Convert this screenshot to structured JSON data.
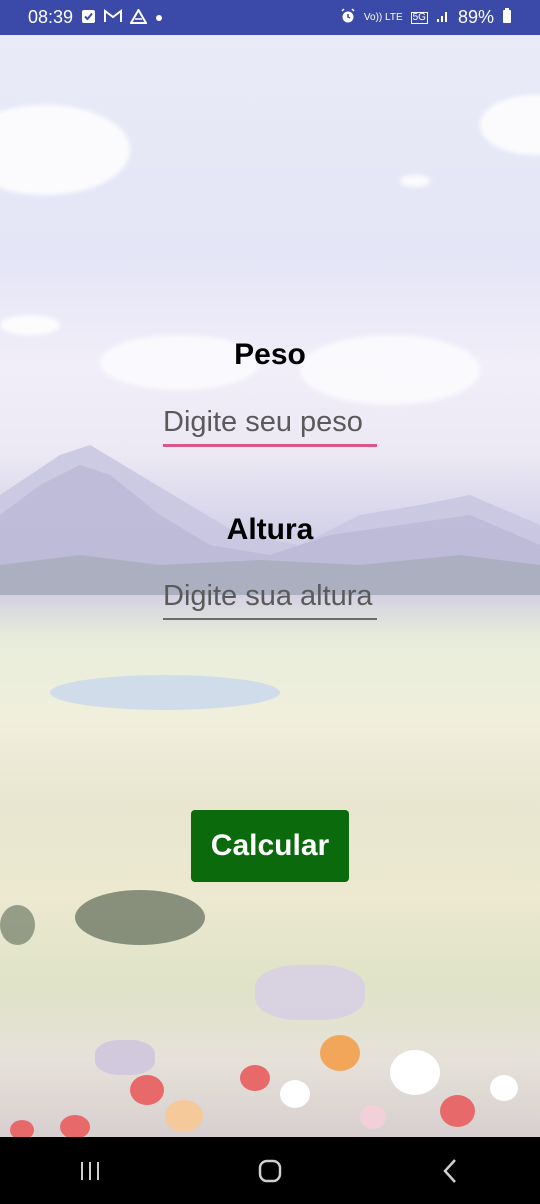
{
  "status_bar": {
    "time": "08:39",
    "left_icons": [
      "checkbox-icon",
      "gmail-icon",
      "drive-icon",
      "dot-icon"
    ],
    "right_icons": [
      "alarm-icon",
      "volte-icon",
      "5g-icon",
      "signal-icon",
      "battery-icon"
    ],
    "volte_text": "Vo)) LTE",
    "network_text": "5G",
    "battery": "89%"
  },
  "form": {
    "peso_label": "Peso",
    "peso_placeholder": "Digite seu peso",
    "altura_label": "Altura",
    "altura_placeholder": "Digite sua altura",
    "calc_button": "Calcular"
  },
  "colors": {
    "status_bar": "#3b4aa8",
    "button": "#0b6a0b",
    "active_underline": "#d8578a"
  },
  "nav_bar": {
    "icons": [
      "recent-apps-icon",
      "home-icon",
      "back-icon"
    ]
  }
}
